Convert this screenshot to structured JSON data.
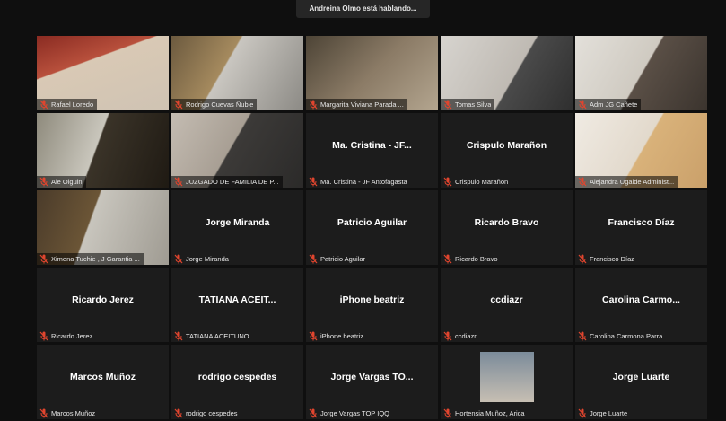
{
  "meeting": {
    "speaking_banner": "Andreina Olmo está hablando..."
  },
  "colors": {
    "mic_muted": "#e0452e",
    "tile_bg": "#1c1c1c",
    "page_bg": "#0f0f0f"
  },
  "participants": [
    {
      "label": "Rafael Loredo",
      "video": true
    },
    {
      "label": "Rodrigo Cuevas Ñuble",
      "video": true
    },
    {
      "label": "Margarita Viviana Parada ...",
      "video": true
    },
    {
      "label": "Tomas Silva",
      "video": true
    },
    {
      "label": "Adm JG Cañete",
      "video": true
    },
    {
      "label": "Ale Olguin",
      "video": true
    },
    {
      "label": "JUZGADO DE FAMILIA DE P...",
      "video": true
    },
    {
      "display": "Ma. Cristina - JF...",
      "label": "Ma. Cristina - JF Antofagasta",
      "video": false
    },
    {
      "display": "Crispulo Marañon",
      "label": "Crispulo Marañon",
      "video": false
    },
    {
      "label": "Alejandra Ugalde Administ...",
      "video": true
    },
    {
      "label": "Ximena Tuchie , J Garantia ...",
      "video": true
    },
    {
      "display": "Jorge Miranda",
      "label": "Jorge Miranda",
      "video": false
    },
    {
      "display": "Patricio Aguilar",
      "label": "Patricio Aguilar",
      "video": false
    },
    {
      "display": "Ricardo Bravo",
      "label": "Ricardo Bravo",
      "video": false
    },
    {
      "display": "Francisco Díaz",
      "label": "Francisco Díaz",
      "video": false
    },
    {
      "display": "Ricardo Jerez",
      "label": "Ricardo Jerez",
      "video": false
    },
    {
      "display": "TATIANA ACEIT...",
      "label": "TATIANA ACEITUNO",
      "video": false
    },
    {
      "display": "iPhone beatriz",
      "label": "iPhone beatriz",
      "video": false
    },
    {
      "display": "ccdiazr",
      "label": "ccdiazr",
      "video": false
    },
    {
      "display": "Carolina Carmo...",
      "label": "Carolina Carmona Parra",
      "video": false
    },
    {
      "display": "Marcos Muñoz",
      "label": "Marcos Muñoz",
      "video": false
    },
    {
      "display": "rodrigo cespedes",
      "label": "rodrigo cespedes",
      "video": false
    },
    {
      "display": "Jorge Vargas TO...",
      "label": "Jorge Vargas TOP IQQ",
      "video": false
    },
    {
      "label": "Hortensia Muñoz, Arica",
      "video": false,
      "avatar": true
    },
    {
      "display": "Jorge Luarte",
      "label": "Jorge Luarte",
      "video": false
    }
  ]
}
